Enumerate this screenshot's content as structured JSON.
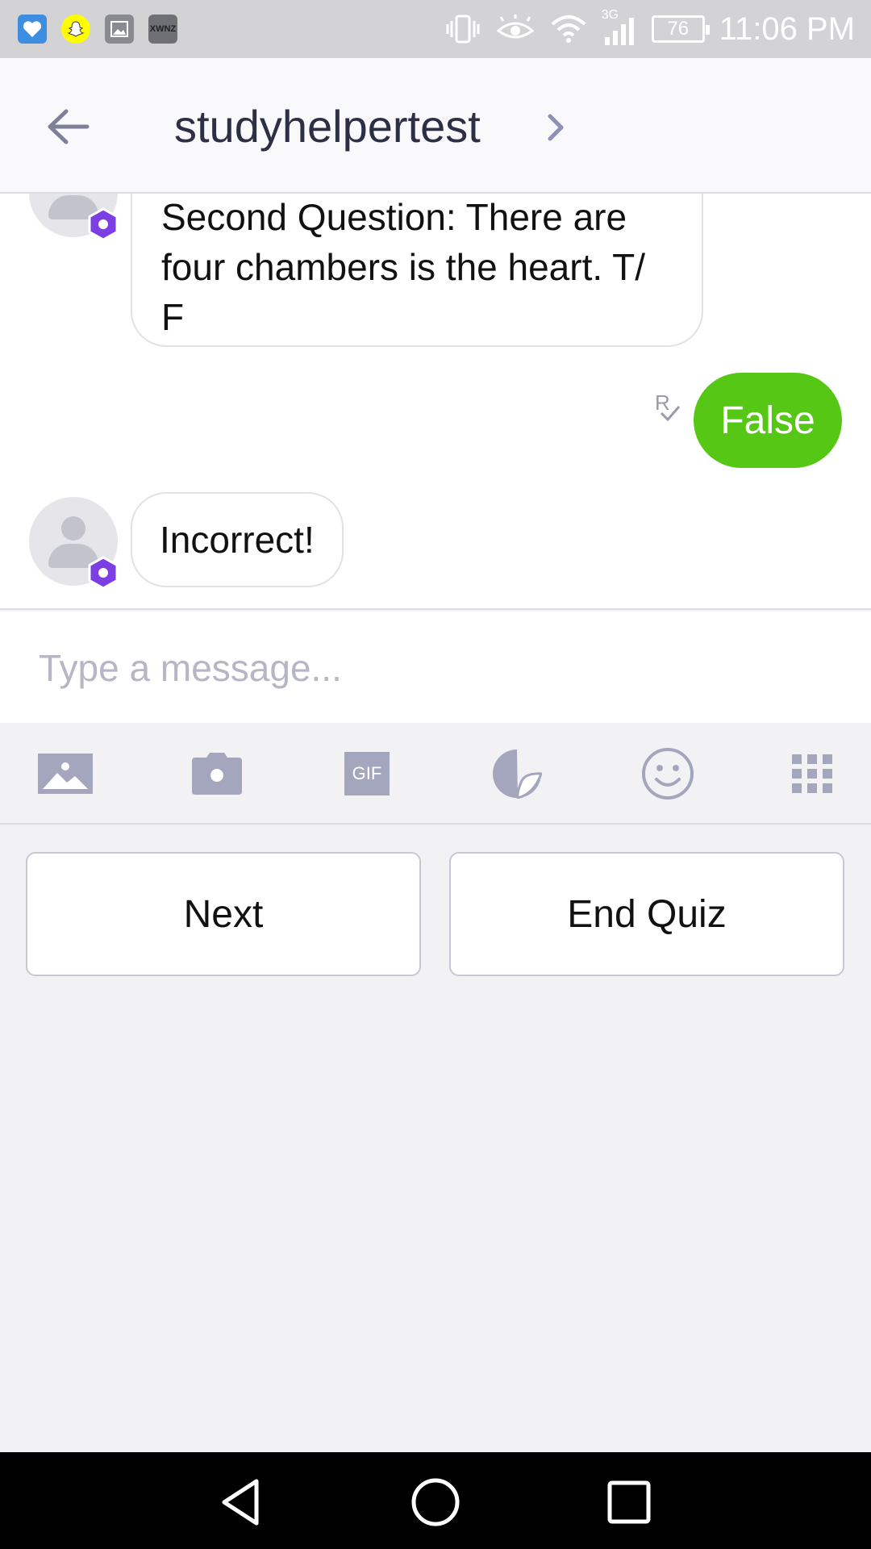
{
  "status_bar": {
    "time": "11:06 PM",
    "battery": "76",
    "network": "3G",
    "app_icons": [
      "health-app-icon",
      "snapchat-icon",
      "gallery-icon",
      "news-app-icon"
    ],
    "news_app_label": "XWNZ"
  },
  "header": {
    "title": "studyhelpertest",
    "back_icon": "arrow-left-icon",
    "chevron_icon": "chevron-right-icon"
  },
  "messages": [
    {
      "sender": "bot",
      "text": "Second Question: There are four chambers is the heart. T/ F"
    },
    {
      "sender": "me",
      "text": "False",
      "receipt": "R"
    },
    {
      "sender": "bot",
      "text": "Incorrect!"
    }
  ],
  "composer": {
    "placeholder": "Type a message..."
  },
  "toolbar": {
    "items": [
      "image-icon",
      "camera-icon",
      "gif-icon",
      "sticker-icon",
      "emoji-icon",
      "grid-icon"
    ],
    "gif_label": "GIF"
  },
  "quick_replies": [
    {
      "label": "Next"
    },
    {
      "label": "End Quiz"
    }
  ],
  "colors": {
    "accent_green": "#57c716",
    "badge_purple": "#7b3fe4",
    "icon_gray": "#a4a6bd",
    "title": "#2d2f45"
  }
}
